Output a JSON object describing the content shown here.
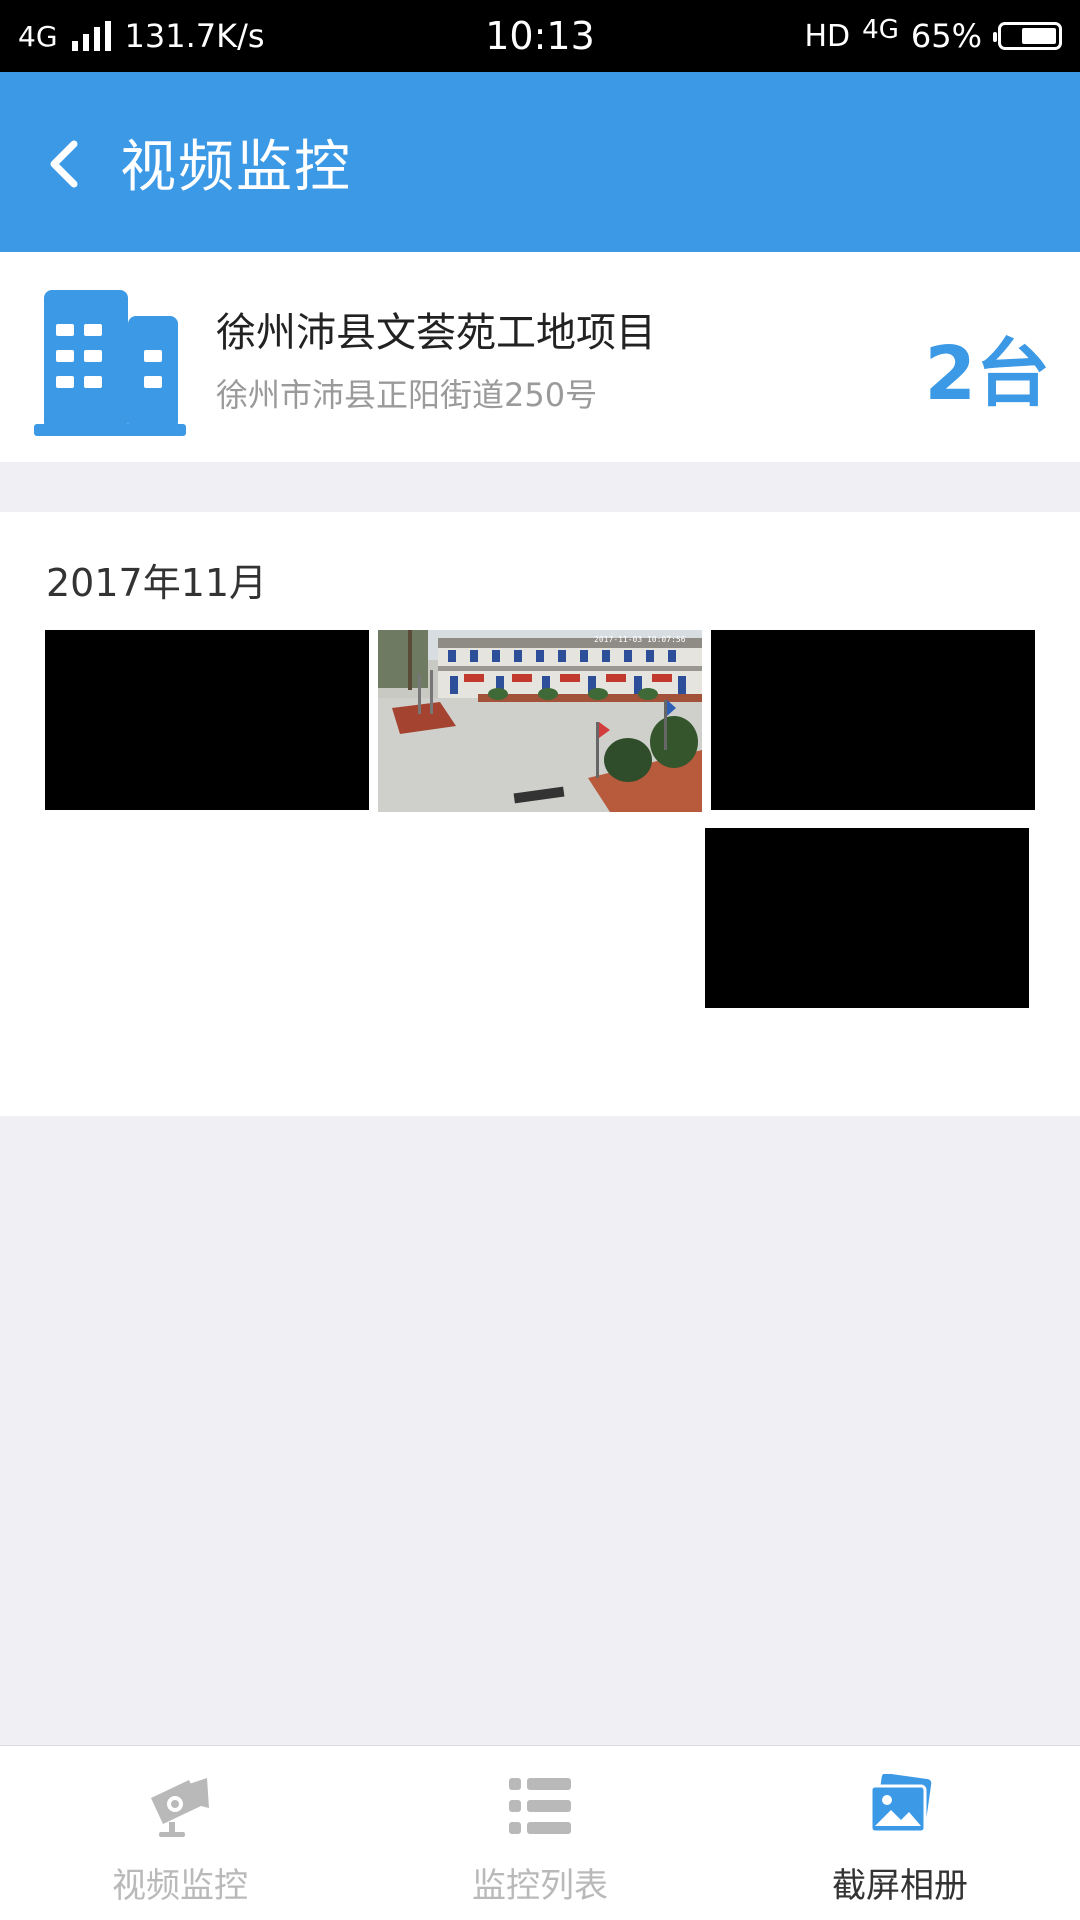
{
  "status_bar": {
    "network": "4G",
    "speed": "131.7K/s",
    "time": "10:13",
    "hd": "HD",
    "network_right": "4G",
    "battery": "65%",
    "battery_level": 0.65
  },
  "nav": {
    "title": "视频监控",
    "back_icon": "chevron-left-icon"
  },
  "project": {
    "icon": "building-icon",
    "name": "徐州沛县文荟苑工地项目",
    "address": "徐州市沛县正阳街道250号",
    "device_count": "2台"
  },
  "gallery": {
    "month": "2017年11月",
    "screenshots": [
      {
        "type": "black"
      },
      {
        "type": "image",
        "timestamp": "2017-11-03 10:07:56"
      },
      {
        "type": "black"
      },
      {
        "type": "black"
      }
    ]
  },
  "tabs": [
    {
      "label": "视频监控",
      "icon": "camera-icon",
      "active": false
    },
    {
      "label": "监控列表",
      "icon": "list-icon",
      "active": false
    },
    {
      "label": "截屏相册",
      "icon": "album-icon",
      "active": true
    }
  ],
  "colors": {
    "primary": "#3b99e6",
    "background": "#efeff4",
    "inactive": "#b9b9b9"
  }
}
